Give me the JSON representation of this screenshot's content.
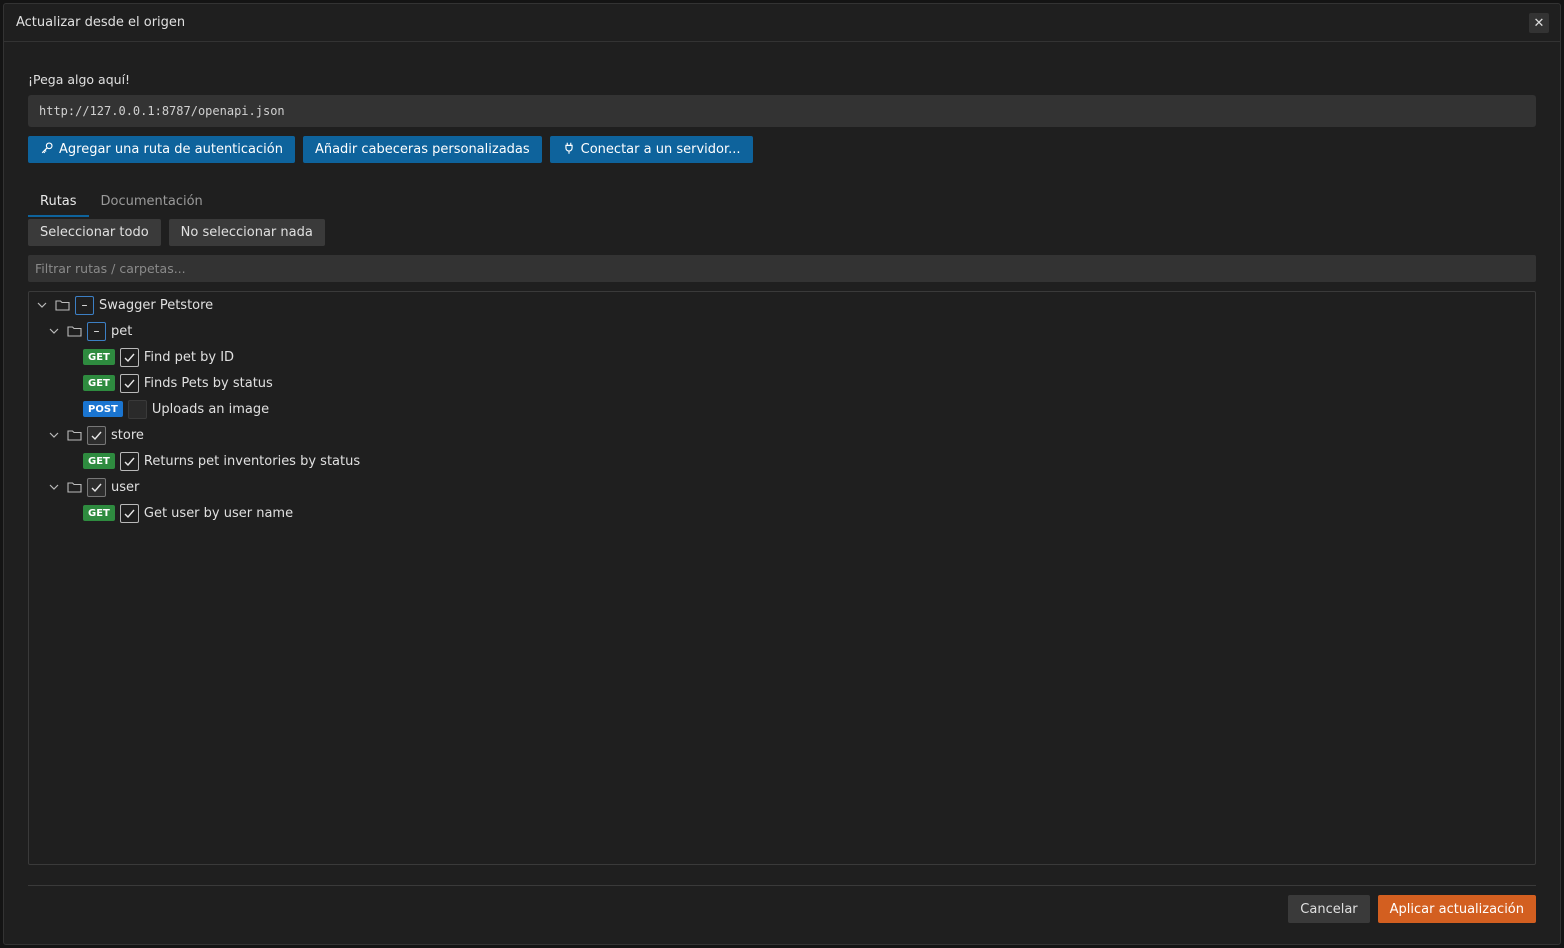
{
  "dialog": {
    "title": "Actualizar desde el origen",
    "close_glyph": "✕"
  },
  "source": {
    "label": "¡Pega algo aquí!",
    "url_value": "http://127.0.0.1:8787/openapi.json"
  },
  "actions": {
    "auth": {
      "label": "Agregar una ruta de autenticación",
      "icon": "key-icon"
    },
    "headers": {
      "label": "Añadir cabeceras personalizadas"
    },
    "connect": {
      "label": "Conectar a un servidor...",
      "icon": "plug-icon"
    }
  },
  "tabs": [
    {
      "label": "Rutas",
      "active": true
    },
    {
      "label": "Documentación",
      "active": false
    }
  ],
  "selection": {
    "select_all": "Seleccionar todo",
    "select_none": "No seleccionar nada"
  },
  "filter": {
    "placeholder": "Filtrar rutas / carpetas..."
  },
  "tree": {
    "root": {
      "label": "Swagger Petstore",
      "state": "partial"
    },
    "folders": [
      {
        "label": "pet",
        "state": "partial",
        "items": [
          {
            "method": "GET",
            "label": "Find pet by ID",
            "checked": true
          },
          {
            "method": "GET",
            "label": "Finds Pets by status",
            "checked": true
          },
          {
            "method": "POST",
            "label": "Uploads an image",
            "checked": false
          }
        ]
      },
      {
        "label": "store",
        "state": "checked",
        "items": [
          {
            "method": "GET",
            "label": "Returns pet inventories by status",
            "checked": true
          }
        ]
      },
      {
        "label": "user",
        "state": "checked",
        "items": [
          {
            "method": "GET",
            "label": "Get user by user name",
            "checked": true
          }
        ]
      }
    ]
  },
  "footer": {
    "cancel": "Cancelar",
    "apply": "Aplicar actualización"
  },
  "colors": {
    "primary": "#0e639c",
    "apply": "#d35f20",
    "get_badge": "#2e8b3f",
    "post_badge": "#1a75d1"
  }
}
